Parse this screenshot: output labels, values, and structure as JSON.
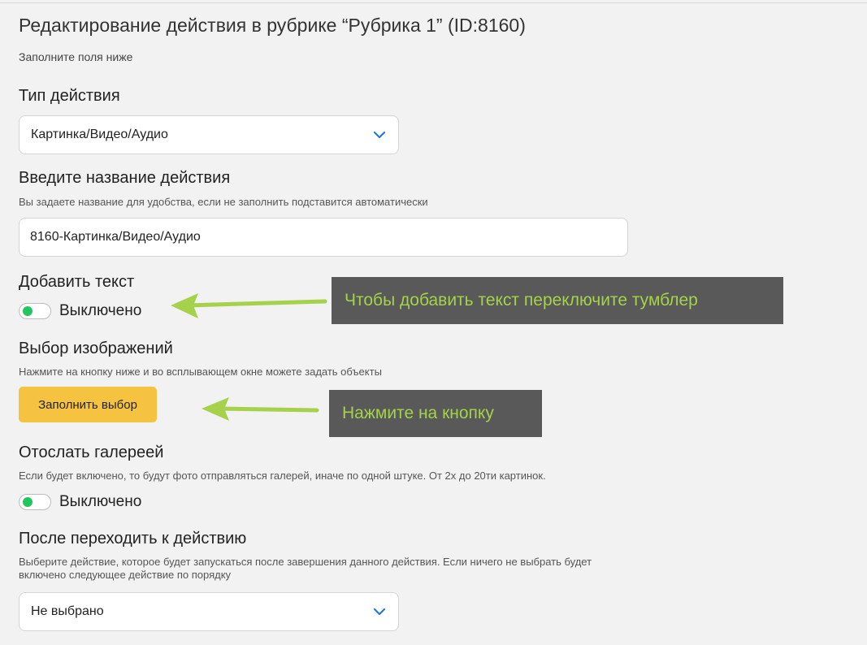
{
  "header": {
    "title": "Редактирование действия в рубрике “Рубрика 1” (ID:8160)",
    "subtitle": "Заполните поля ниже"
  },
  "action_type": {
    "label": "Тип действия",
    "selected": "Картинка/Видео/Аудио"
  },
  "action_name": {
    "label": "Введите название действия",
    "hint": "Вы задаете название для удобства, если не заполнить подставится автоматически",
    "value": "8160-Картинка/Видео/Аудио"
  },
  "add_text": {
    "label": "Добавить текст",
    "toggle_state": "Выключено"
  },
  "image_select": {
    "label": "Выбор изображений",
    "hint": "Нажмите на кнопку ниже и во всплывающем окне можете задать объекты",
    "button_label": "Заполнить выбор"
  },
  "gallery": {
    "label": "Отослать галереей",
    "hint": "Если будет включено, то будут фото отправляться галерей, иначе по одной штуке. От 2х до 20ти картинок.",
    "toggle_state": "Выключено"
  },
  "next_action": {
    "label": "После переходить к действию",
    "hint_line1": "Выберите действие, которое будет запускаться после завершения данного действия. Если ничего не выбрать будет",
    "hint_line2": "включено следующее действие по порядку",
    "selected": "Не выбрано"
  },
  "annotations": {
    "toggle_callout": "Чтобы добавить текст переключите тумблер",
    "button_callout": "Нажмите на кнопку"
  },
  "colors": {
    "background": "#f2f2f2",
    "button": "#f5c33f",
    "toggle_knob": "#22c55e",
    "chevron": "#1a73e8",
    "callout_bg": "#595959",
    "callout_text": "#a5d24a",
    "arrow": "#a5d24a"
  },
  "icons": {
    "select_chevron": "chevron-down-icon",
    "annotation_arrow": "arrow-left-icon"
  }
}
